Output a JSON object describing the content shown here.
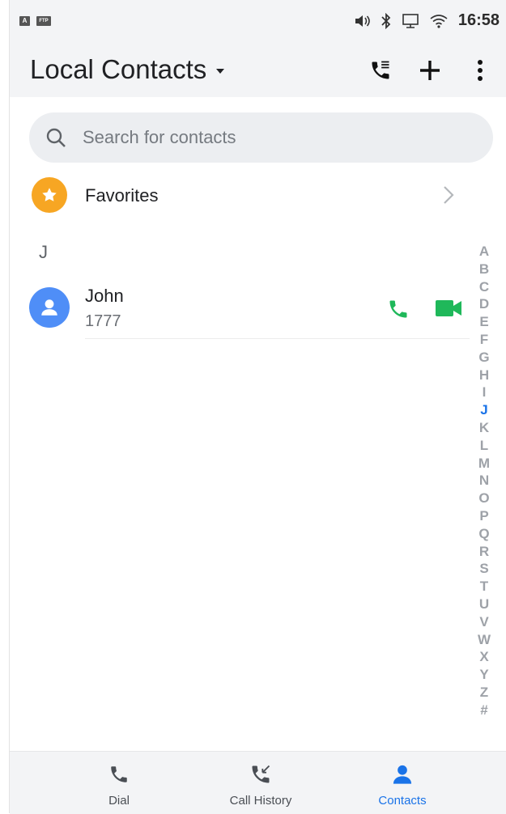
{
  "status_bar": {
    "left_icons": [
      "A",
      "FTP"
    ],
    "right_icons": [
      "volume-icon",
      "bluetooth-icon",
      "network-icon",
      "wifi-icon"
    ],
    "time": "16:58"
  },
  "header": {
    "title": "Local Contacts",
    "actions": [
      "call-log-icon",
      "add-icon",
      "more-icon"
    ]
  },
  "search": {
    "placeholder": "Search for contacts"
  },
  "favorites": {
    "label": "Favorites"
  },
  "section": {
    "letter": "J"
  },
  "contacts": [
    {
      "name": "John",
      "number": "1777"
    }
  ],
  "alphabet": [
    "A",
    "B",
    "C",
    "D",
    "E",
    "F",
    "G",
    "H",
    "I",
    "J",
    "K",
    "L",
    "M",
    "N",
    "O",
    "P",
    "Q",
    "R",
    "S",
    "T",
    "U",
    "V",
    "W",
    "X",
    "Y",
    "Z",
    "#"
  ],
  "alphabet_active": "J",
  "nav": {
    "items": [
      {
        "label": "Dial",
        "icon": "phone-icon"
      },
      {
        "label": "Call History",
        "icon": "call-history-icon"
      },
      {
        "label": "Contacts",
        "icon": "person-icon"
      }
    ],
    "active": "Contacts"
  },
  "colors": {
    "accent": "#1a73e8",
    "call_green": "#1fb85a",
    "favorite_orange": "#f7a623",
    "avatar_blue": "#4f8ef7"
  }
}
